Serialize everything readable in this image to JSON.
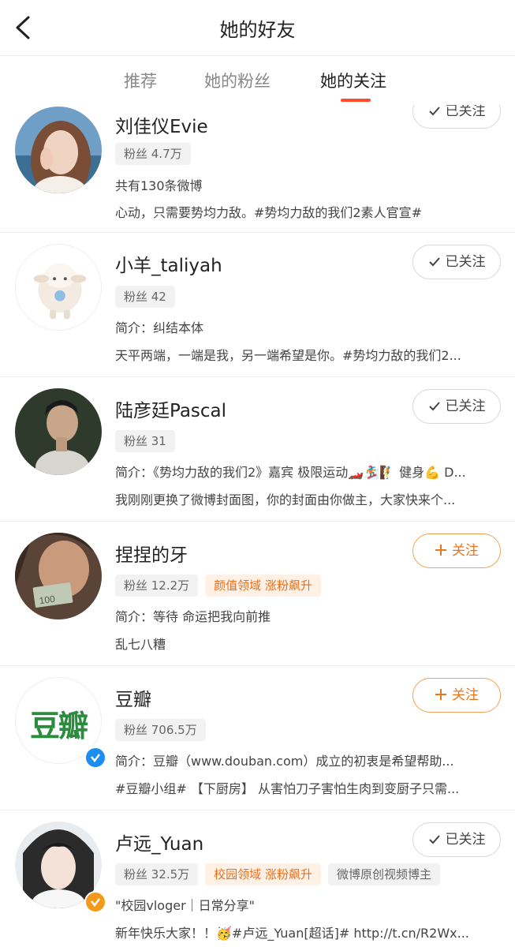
{
  "header": {
    "title": "她的好友",
    "back_icon": "back-arrow-icon"
  },
  "tabs": [
    {
      "label": "推荐",
      "active": false
    },
    {
      "label": "她的粉丝",
      "active": false
    },
    {
      "label": "她的关注",
      "active": true
    }
  ],
  "accent_color": "#ff4b2b",
  "users": [
    {
      "name": "刘佳仪Evie",
      "tags": [
        {
          "text": "粉丝 4.7万",
          "style": "gray"
        }
      ],
      "line1": "共有130条微博",
      "line2": "心动，只需要势均力敌。#势均力敌的我们2素人官宣#",
      "button": "已关注",
      "followed": true,
      "verified": null
    },
    {
      "name": "小羊_taliyah",
      "tags": [
        {
          "text": "粉丝 42",
          "style": "gray"
        }
      ],
      "line1": "简介：纠结本体",
      "line2": "天平两端，一端是我，另一端希望是你。#势均力敌的我们2...",
      "button": "已关注",
      "followed": true,
      "verified": null
    },
    {
      "name": "陆彦廷Pascal",
      "tags": [
        {
          "text": "粉丝 31",
          "style": "gray"
        }
      ],
      "line1": "简介：《势均力敌的我们2》嘉宾 极限运动🏎️🏂🧗 健身💪 D...",
      "line2": "我刚刚更换了微博封面图，你的封面由你做主，大家快来个...",
      "button": "已关注",
      "followed": true,
      "verified": null
    },
    {
      "name": "捏捏的牙",
      "tags": [
        {
          "text": "粉丝 12.2万",
          "style": "gray"
        },
        {
          "text": "颜值领域 涨粉飙升",
          "style": "orange"
        }
      ],
      "line1": "简介：等待 命运把我向前推",
      "line2": "乱七八糟",
      "button": "关注",
      "followed": false,
      "verified": null
    },
    {
      "name": "豆瓣",
      "avatar_text": "豆瓣",
      "tags": [
        {
          "text": "粉丝 706.5万",
          "style": "gray"
        }
      ],
      "line1": "简介：豆瓣（www.douban.com）成立的初衷是希望帮助...",
      "line2": "#豆瓣小组# 【下厨房】 从害怕刀子害怕生肉到变厨子只需...",
      "button": "关注",
      "followed": false,
      "verified": "blue"
    },
    {
      "name": "卢远_Yuan",
      "tags": [
        {
          "text": "粉丝 32.5万",
          "style": "gray"
        },
        {
          "text": "校园领域 涨粉飙升",
          "style": "orange"
        },
        {
          "text": "微博原创视频博主",
          "style": "gray"
        }
      ],
      "line1": "\"校园vloger｜日常分享\"",
      "line2": "新年快乐大家！！🥳#卢远_Yuan[超话]# http://t.cn/R2Wx...",
      "button": "已关注",
      "followed": true,
      "verified": "orange"
    }
  ]
}
